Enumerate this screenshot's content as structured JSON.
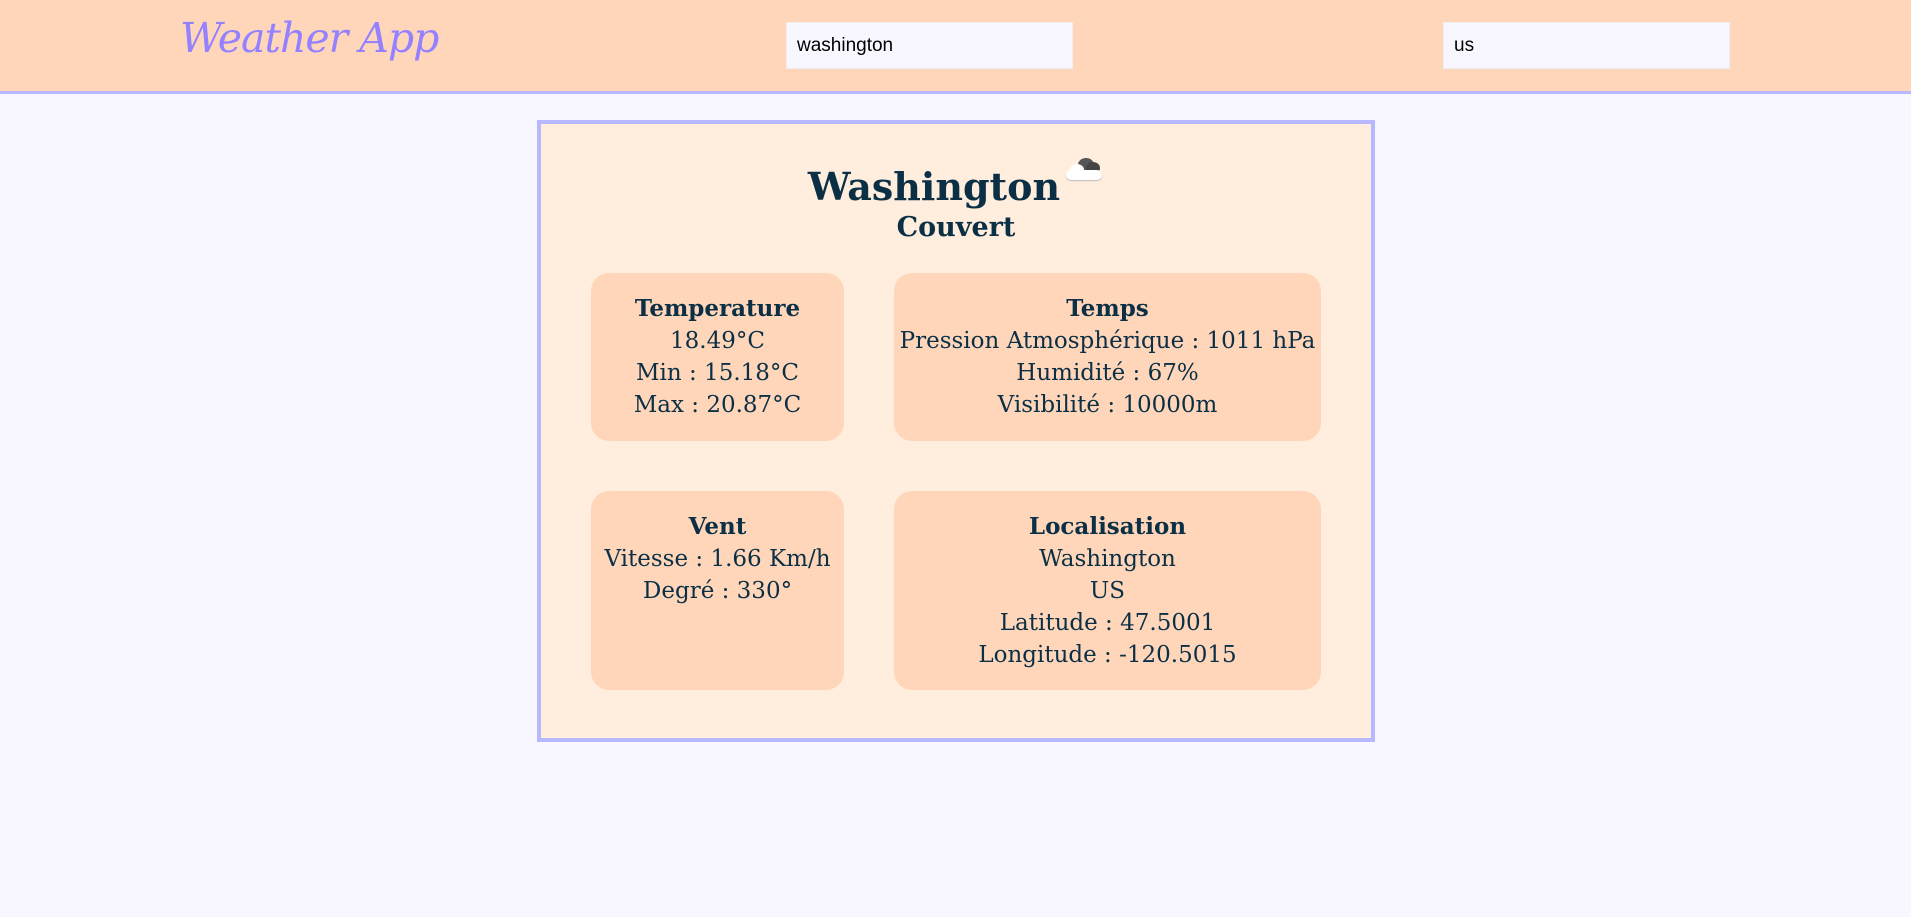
{
  "header": {
    "logo": "Weather App",
    "city_input_value": "washington",
    "country_input_value": "us"
  },
  "weather": {
    "city": "Washington",
    "icon": "overcast-cloud-icon",
    "description": "Couvert",
    "temperature": {
      "title": "Temperature",
      "current": "18.49°C",
      "min": "Min : 15.18°C",
      "max": "Max : 20.87°C"
    },
    "temps": {
      "title": "Temps",
      "pressure": "Pression Atmosphérique : 1011 hPa",
      "humidity": "Humidité : 67%",
      "visibility": "Visibilité : 10000m"
    },
    "vent": {
      "title": "Vent",
      "speed": "Vitesse : 1.66 Km/h",
      "degree": "Degré : 330°"
    },
    "localisation": {
      "title": "Localisation",
      "city": "Washington",
      "country": "US",
      "latitude": "Latitude : 47.5001",
      "longitude": "Longitude : -120.5015"
    }
  },
  "colors": {
    "header_bg": "#ffd6ba",
    "page_bg": "#f8f7ff",
    "card_bg": "#ffeedd",
    "accent": "#b8b8ff",
    "logo": "#9381ff",
    "text": "#0b2f45"
  }
}
